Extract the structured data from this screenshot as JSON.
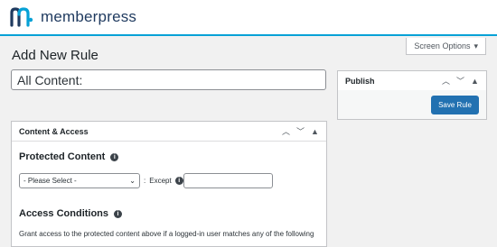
{
  "brand": {
    "name": "memberpress",
    "accent": "#06a1d6",
    "logo_color": "#1f3a5f"
  },
  "screen_options": {
    "label": "Screen Options",
    "icon": "caret-down-icon"
  },
  "page": {
    "title": "Add New Rule",
    "title_input_value": "All Content:"
  },
  "publish": {
    "title": "Publish",
    "save_label": "Save Rule",
    "button_color": "#2271b1"
  },
  "content_access": {
    "title": "Content & Access",
    "protected_content_heading": "Protected Content",
    "select_value": "- Please Select -",
    "except_label": "Except",
    "except_value": "",
    "access_conditions_heading": "Access Conditions",
    "access_conditions_desc": "Grant access to the protected content above if a logged-in user matches any of the following"
  }
}
